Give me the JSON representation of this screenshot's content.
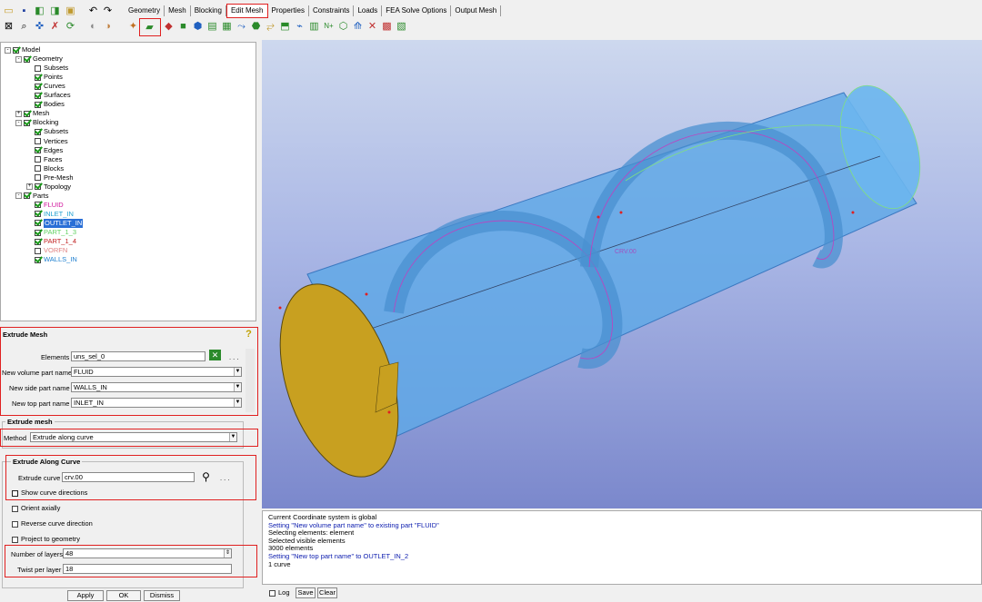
{
  "toolbar": {
    "tabs": [
      {
        "label": "Geometry"
      },
      {
        "label": "Mesh"
      },
      {
        "label": "Blocking"
      },
      {
        "label": "Edit Mesh",
        "active": true
      },
      {
        "label": "Properties"
      },
      {
        "label": "Constraints"
      },
      {
        "label": "Loads"
      },
      {
        "label": "FEA Solve Options"
      },
      {
        "label": "Output Mesh"
      }
    ],
    "left_icons_row1": [
      "open-icon",
      "save-icon",
      "import-icon",
      "export-icon",
      "undo-icon",
      "redo-icon"
    ],
    "left_icons_row2": [
      "fit-icon",
      "zoom-icon",
      "measure-icon",
      "select-icon",
      "refresh-icon",
      "shade-icon"
    ],
    "mesh_icons": [
      "check-mesh-icon",
      "extrude-mesh-icon",
      "repair-icon",
      "smooth-icon",
      "convert-icon",
      "adjust-icon",
      "move-nodes-icon",
      "transform-icon",
      "renumber-icon",
      "merge-icon",
      "split-icon",
      "delete-icon",
      "reorient-icon",
      "edit-icon",
      "partition-icon",
      "mirror-icon",
      "info-icon",
      "reset-icon",
      "crop-icon"
    ]
  },
  "tree": {
    "items": [
      {
        "label": "Model",
        "level": 0,
        "expander": "-",
        "checked": true,
        "color": "#000000"
      },
      {
        "label": "Geometry",
        "level": 1,
        "expander": "-",
        "checked": true,
        "color": "#000000"
      },
      {
        "label": "Subsets",
        "level": 2,
        "checked": false,
        "color": "#000000"
      },
      {
        "label": "Points",
        "level": 2,
        "checked": true,
        "color": "#000000"
      },
      {
        "label": "Curves",
        "level": 2,
        "checked": true,
        "color": "#000000"
      },
      {
        "label": "Surfaces",
        "level": 2,
        "checked": true,
        "color": "#000000"
      },
      {
        "label": "Bodies",
        "level": 2,
        "checked": true,
        "color": "#000000"
      },
      {
        "label": "Mesh",
        "level": 1,
        "expander": "+",
        "checked": true,
        "color": "#000000"
      },
      {
        "label": "Blocking",
        "level": 1,
        "expander": "-",
        "checked": true,
        "color": "#000000"
      },
      {
        "label": "Subsets",
        "level": 2,
        "checked": true,
        "color": "#000000"
      },
      {
        "label": "Vertices",
        "level": 2,
        "checked": false,
        "color": "#000000"
      },
      {
        "label": "Edges",
        "level": 2,
        "checked": true,
        "color": "#000000"
      },
      {
        "label": "Faces",
        "level": 2,
        "checked": false,
        "color": "#000000"
      },
      {
        "label": "Blocks",
        "level": 2,
        "checked": false,
        "color": "#000000"
      },
      {
        "label": "Pre-Mesh",
        "level": 2,
        "checked": false,
        "color": "#000000"
      },
      {
        "label": "Topology",
        "level": 2,
        "expander": "+",
        "checked": true,
        "color": "#000000"
      },
      {
        "label": "Parts",
        "level": 1,
        "expander": "-",
        "checked": true,
        "color": "#000000"
      },
      {
        "label": "FLUID",
        "level": 2,
        "checked": true,
        "color": "#d0109a"
      },
      {
        "label": "INLET_IN",
        "level": 2,
        "checked": true,
        "color": "#20a0d0"
      },
      {
        "label": "OUTLET_IN",
        "level": 2,
        "checked": true,
        "color": "#ffffff",
        "selected": true
      },
      {
        "label": "PART_1_3",
        "level": 2,
        "checked": true,
        "color": "#60d060"
      },
      {
        "label": "PART_1_4",
        "level": 2,
        "checked": true,
        "color": "#c02020"
      },
      {
        "label": "VORFN",
        "level": 2,
        "checked": false,
        "color": "#e08080"
      },
      {
        "label": "WALLS_IN",
        "level": 2,
        "checked": true,
        "color": "#2080d0"
      }
    ]
  },
  "panel": {
    "title": "Extrude Mesh",
    "elements_label": "Elements",
    "elements_value": "uns_sel_0",
    "ellipsis": ". . .",
    "volume_label": "New volume part name",
    "volume_value": "FLUID",
    "side_label": "New side part name",
    "side_value": "WALLS_IN",
    "top_label": "New top part name",
    "top_value": "INLET_IN",
    "extrude_group": "Extrude mesh",
    "method_label": "Method",
    "method_value": "Extrude along curve",
    "along_group": "Extrude Along Curve",
    "curve_label": "Extrude curve",
    "curve_value": "crv.00",
    "show_dirs": "Show curve directions",
    "orient": "Orient axially",
    "reverse": "Reverse curve direction",
    "project": "Project to geometry",
    "layers_label": "Number of layers",
    "layers_value": "48",
    "twist_label": "Twist per layer",
    "twist_value": "18",
    "apply": "Apply",
    "ok": "OK",
    "dismiss": "Dismiss"
  },
  "viewport": {
    "curve_label": "CRV.00"
  },
  "messages": [
    {
      "text": "Current Coordinate system is global",
      "color": "black"
    },
    {
      "text": "Setting \"New volume part name\" to existing part \"FLUID\"",
      "color": "blue"
    },
    {
      "text": "Selecting elements: element",
      "color": "black"
    },
    {
      "text": "Selected visible elements",
      "color": "black"
    },
    {
      "text": "3000 elements",
      "color": "black"
    },
    {
      "text": "Setting \"New top part name\" to OUTLET_IN_2",
      "color": "blue"
    },
    {
      "text": "1 curve",
      "color": "black"
    }
  ],
  "bottom": {
    "log": "Log",
    "save": "Save",
    "clear": "Clear"
  },
  "colors": {
    "cylinder": "#5ea8e6",
    "mesh": "#c8a020",
    "highlight": "#e02020"
  }
}
